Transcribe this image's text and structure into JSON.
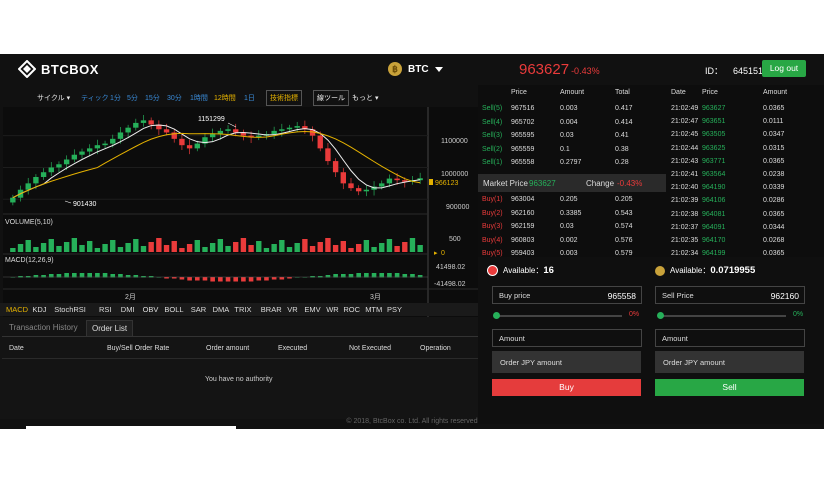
{
  "header": {
    "logo_text": "BTCBOX",
    "coin": "BTC",
    "coin_symbol": "฿",
    "price": "963627",
    "change": "-0.43%",
    "id_label": "ID：",
    "id_value": "645151",
    "logout_label": "Log out"
  },
  "toolbar": {
    "cycle": "サイクル ▾",
    "tick": "ティック",
    "m1": "1分",
    "m5": "5分",
    "m15": "15分",
    "m30": "30分",
    "h1": "1時間",
    "h12": "12時間",
    "d1": "1日",
    "indicators": "技術指標",
    "draw": "線ツール",
    "more": "もっと ▾"
  },
  "chart": {
    "high_label": "1151299",
    "low_label": "901430",
    "price_ticks": [
      "1100000",
      "1000000",
      "900000"
    ],
    "current_price_label": "966123",
    "volume_label": "VOLUME(5,10)",
    "volume_ticks": [
      "500",
      "0"
    ],
    "macd_label": "MACD(12,26,9)",
    "macd_ticks": [
      "41498.02",
      "-41498.02"
    ],
    "x_labels": [
      "2月",
      "3月"
    ]
  },
  "chart_data": {
    "type": "candlestick",
    "x_labels": [
      "2月",
      "3月"
    ],
    "y_ticks": [
      900000,
      1000000,
      1100000
    ],
    "ylim": [
      860000,
      1190000
    ],
    "marked_high": 1151299,
    "marked_low": 901430,
    "last_price": 966123,
    "close": [
      905000,
      930000,
      950000,
      970000,
      985000,
      1000000,
      1010000,
      1025000,
      1040000,
      1050000,
      1060000,
      1070000,
      1075000,
      1090000,
      1110000,
      1125000,
      1140000,
      1148000,
      1135000,
      1120000,
      1110000,
      1090000,
      1070000,
      1060000,
      1075000,
      1095000,
      1105000,
      1115000,
      1120000,
      1110000,
      1100000,
      1095000,
      1100000,
      1105000,
      1115000,
      1120000,
      1125000,
      1130000,
      1120000,
      1100000,
      1060000,
      1020000,
      985000,
      950000,
      935000,
      925000,
      930000,
      940000,
      950000,
      965000,
      960000,
      955000,
      960000,
      966123
    ]
  },
  "indicators": [
    "MACD",
    "KDJ",
    "StochRSI",
    "RSI",
    "DMI",
    "OBV",
    "BOLL",
    "SAR",
    "DMA",
    "TRIX",
    "BRAR",
    "VR",
    "EMV",
    "WR",
    "ROC",
    "MTM",
    "PSY"
  ],
  "history": {
    "tabs": [
      "Transaction History",
      "Order List"
    ],
    "columns": [
      "Date",
      "Buy/Sell Order Rate",
      "Order amount",
      "Executed",
      "Not Executed",
      "Operation"
    ],
    "empty_message": "You have no authority"
  },
  "orderbook": {
    "headers": [
      "Price",
      "Amount",
      "Total"
    ],
    "sells": [
      {
        "label": "Sell(5)",
        "price": "967516",
        "amount": "0.003",
        "total": "0.417"
      },
      {
        "label": "Sell(4)",
        "price": "965702",
        "amount": "0.004",
        "total": "0.414"
      },
      {
        "label": "Sell(3)",
        "price": "965595",
        "amount": "0.03",
        "total": "0.41"
      },
      {
        "label": "Sell(2)",
        "price": "965559",
        "amount": "0.1",
        "total": "0.38"
      },
      {
        "label": "Sell(1)",
        "price": "965558",
        "amount": "0.2797",
        "total": "0.28"
      }
    ],
    "market_price_label": "Market Price",
    "market_price": "963627",
    "change_label": "Change",
    "change": "-0.43%",
    "buys": [
      {
        "label": "Buy(1)",
        "price": "963004",
        "amount": "0.205",
        "total": "0.205"
      },
      {
        "label": "Buy(2)",
        "price": "962160",
        "amount": "0.3385",
        "total": "0.543"
      },
      {
        "label": "Buy(3)",
        "price": "962159",
        "amount": "0.03",
        "total": "0.574"
      },
      {
        "label": "Buy(4)",
        "price": "960803",
        "amount": "0.002",
        "total": "0.576"
      },
      {
        "label": "Buy(5)",
        "price": "959403",
        "amount": "0.003",
        "total": "0.579"
      }
    ]
  },
  "trades": {
    "headers": [
      "Date",
      "Price",
      "Amount"
    ],
    "rows": [
      {
        "time": "21:02:49",
        "price": "963627",
        "amount": "0.0365"
      },
      {
        "time": "21:02:47",
        "price": "963651",
        "amount": "0.0111"
      },
      {
        "time": "21:02:45",
        "price": "963505",
        "amount": "0.0347"
      },
      {
        "time": "21:02:44",
        "price": "963625",
        "amount": "0.0315"
      },
      {
        "time": "21:02:43",
        "price": "963771",
        "amount": "0.0365"
      },
      {
        "time": "21:02:41",
        "price": "963564",
        "amount": "0.0238"
      },
      {
        "time": "21:02:40",
        "price": "964190",
        "amount": "0.0339"
      },
      {
        "time": "21:02:39",
        "price": "964106",
        "amount": "0.0286"
      },
      {
        "time": "21:02:38",
        "price": "964081",
        "amount": "0.0365"
      },
      {
        "time": "21:02:37",
        "price": "964091",
        "amount": "0.0344"
      },
      {
        "time": "21:02:35",
        "price": "964170",
        "amount": "0.0268"
      },
      {
        "time": "21:02:34",
        "price": "964199",
        "amount": "0.0365"
      }
    ]
  },
  "buy_form": {
    "available_label": "Available：",
    "available_value": "16",
    "price_label": "Buy price",
    "price_value": "965558",
    "percent": "0%",
    "amount_label": "Amount",
    "jpy_label": "Order JPY amount",
    "button": "Buy"
  },
  "sell_form": {
    "available_label": "Available：",
    "available_value": "0.0719955",
    "price_label": "Sell Price",
    "price_value": "962160",
    "percent": "0%",
    "amount_label": "Amount",
    "jpy_label": "Order JPY amount",
    "button": "Sell"
  },
  "footer": "© 2018, BtcBox co. Ltd. All rights reserved",
  "colors": {
    "up": "#26b05a",
    "down": "#ea3b3b",
    "accent": "#e5b200",
    "link": "#3a8bd8"
  }
}
